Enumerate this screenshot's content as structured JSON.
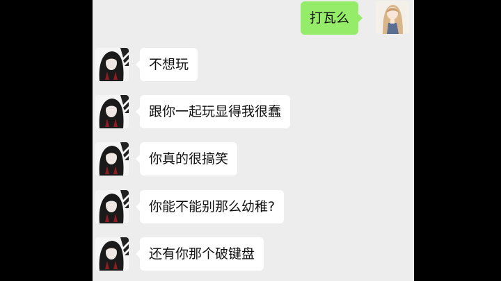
{
  "colors": {
    "chat_background": "#ededed",
    "incoming_bubble": "#ffffff",
    "outgoing_bubble": "#95ec69",
    "letterbox": "#000000"
  },
  "messages": [
    {
      "sender": "me",
      "text": "打瓦么"
    },
    {
      "sender": "friend",
      "text": "不想玩"
    },
    {
      "sender": "friend",
      "text": "跟你一起玩显得我很蠢"
    },
    {
      "sender": "friend",
      "text": "你真的很搞笑"
    },
    {
      "sender": "friend",
      "text": "你能不能别那么幼稚?"
    },
    {
      "sender": "friend",
      "text": "还有你那个破键盘"
    }
  ]
}
